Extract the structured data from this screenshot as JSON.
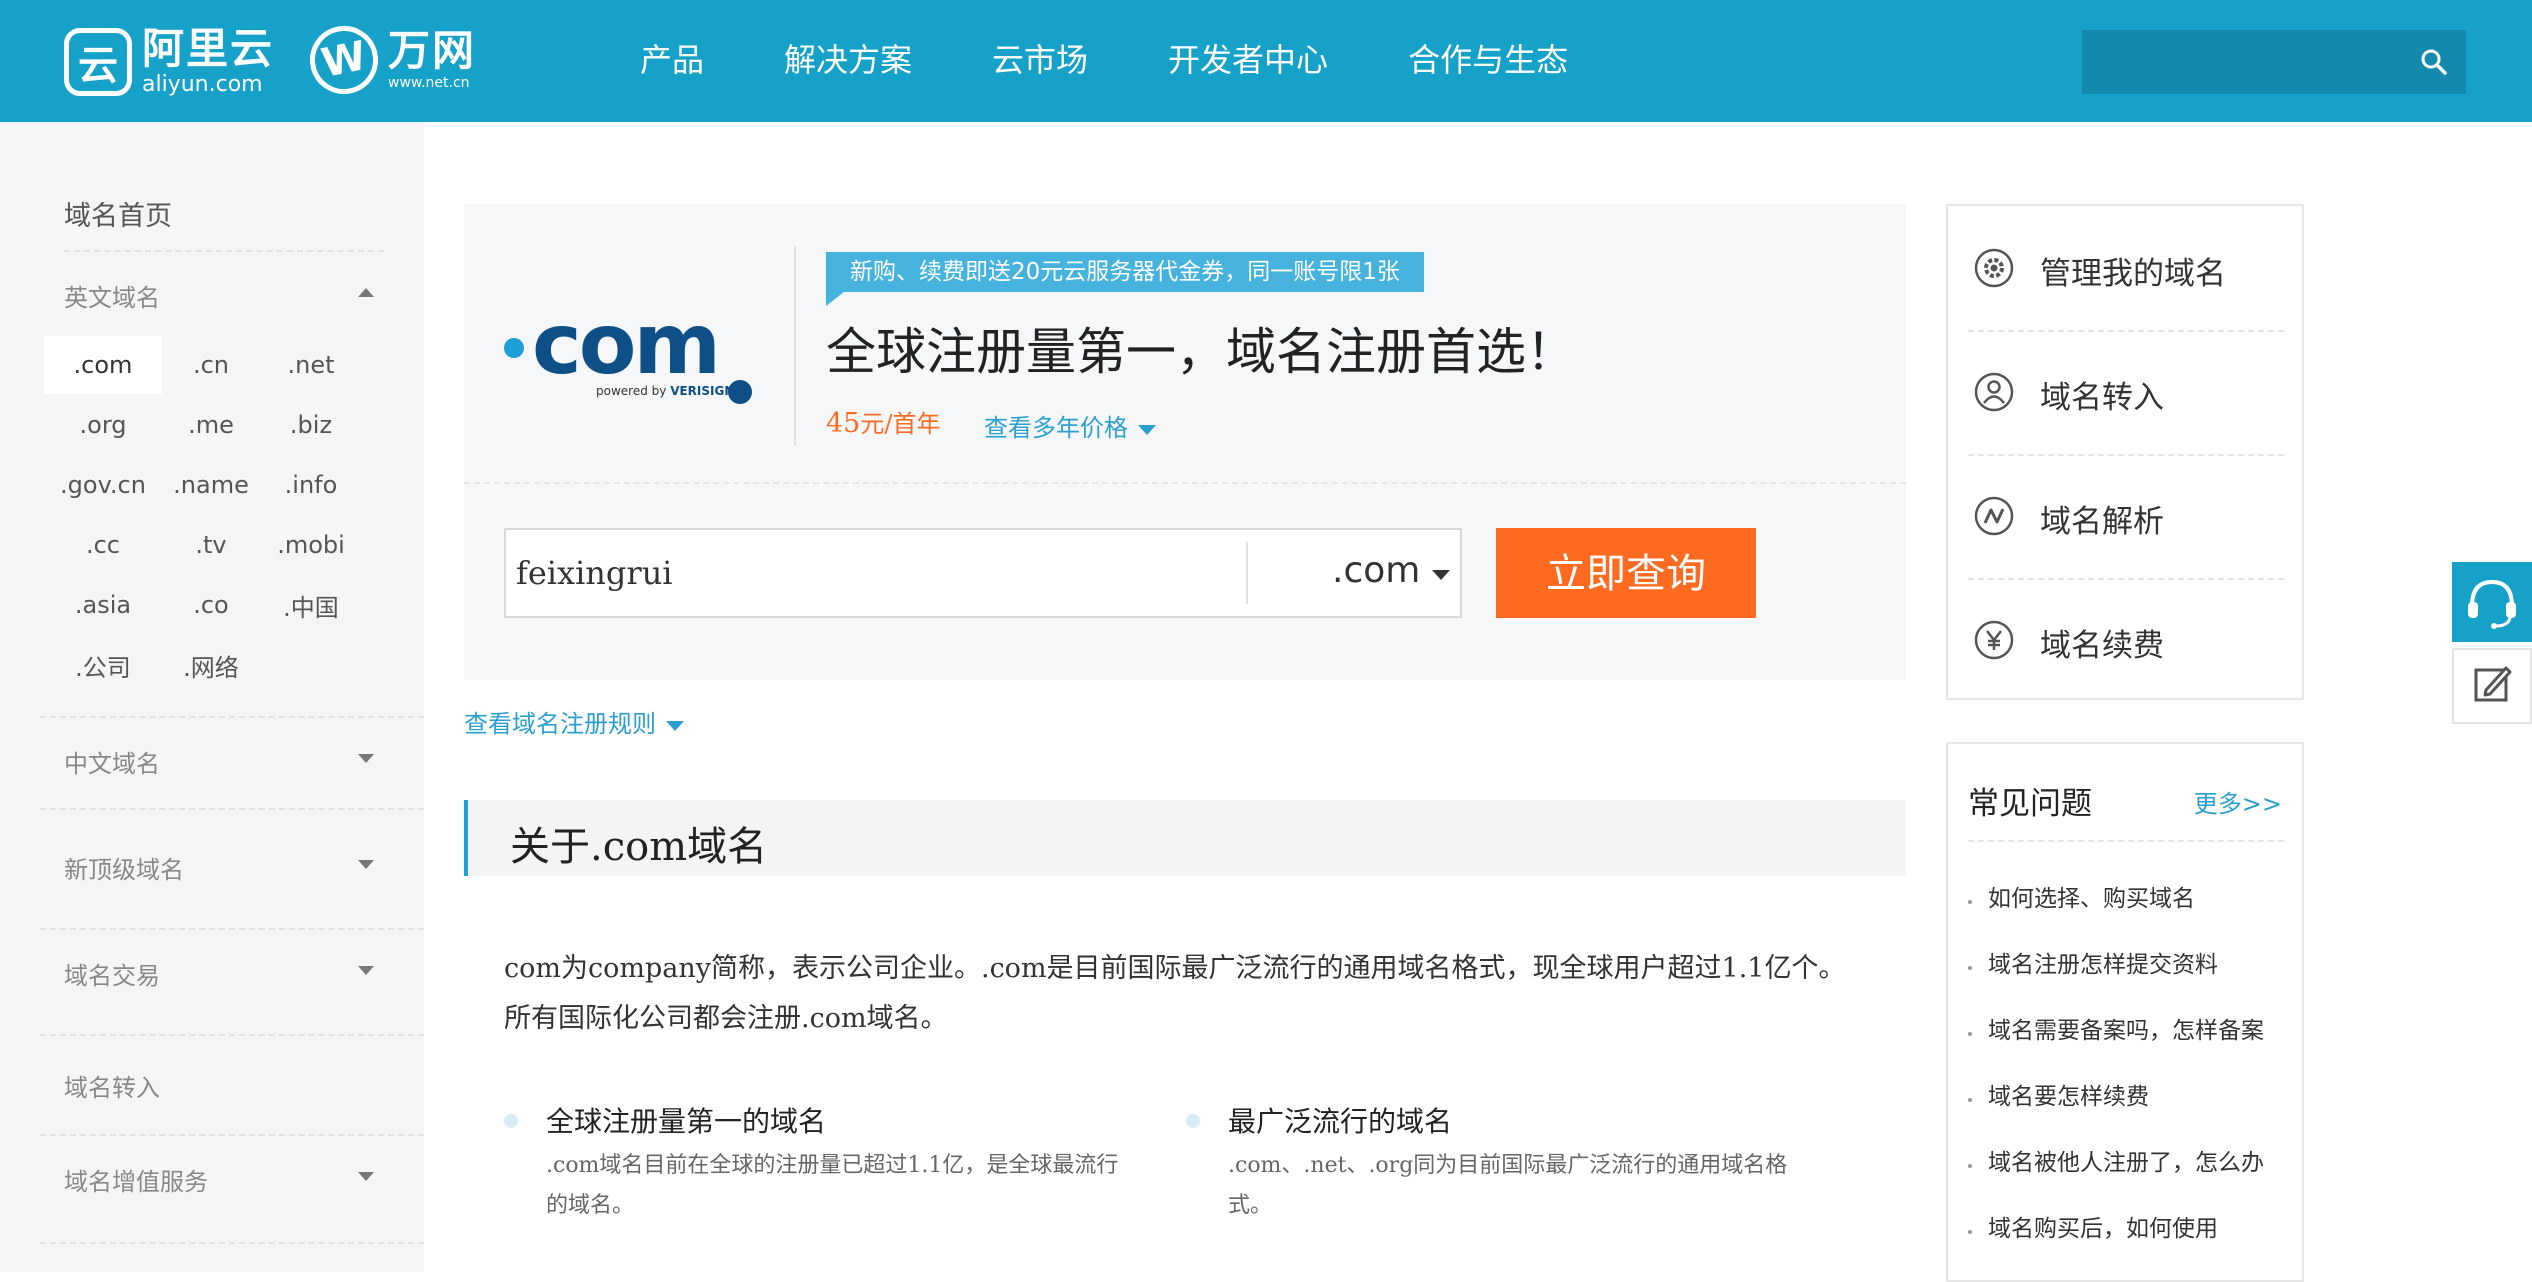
{
  "header": {
    "brand": {
      "name": "阿里云",
      "domain": "aliyun.com",
      "partner_name": "万网",
      "partner_domain": "www.net.cn"
    },
    "nav": [
      "产品",
      "解决方案",
      "云市场",
      "开发者中心",
      "合作与生态"
    ],
    "search_placeholder": ""
  },
  "sidebar": {
    "home": "域名首页",
    "english_domains": {
      "label": "英文域名",
      "tlds": [
        ".com",
        ".cn",
        ".net",
        ".org",
        ".me",
        ".biz",
        ".gov.cn",
        ".name",
        ".info",
        ".cc",
        ".tv",
        ".mobi",
        ".asia",
        ".co",
        ".中国",
        ".公司",
        ".网络"
      ],
      "selected": ".com"
    },
    "sections": [
      "中文域名",
      "新顶级域名",
      "域名交易",
      "域名转入",
      "域名增值服务"
    ]
  },
  "product": {
    "logo_text": "com",
    "logo_powered": "powered by",
    "logo_brand": "VERISIGN",
    "promo": "新购、续费即送20元云服务器代金券，同一账号限1张",
    "headline": "全球注册量第一，域名注册首选！",
    "price_value": "45",
    "price_unit": "元/首年",
    "multi_year_link": "查看多年价格"
  },
  "query": {
    "value": "feixingrui",
    "suffix": ".com",
    "button": "立即查询"
  },
  "rules_link": "查看域名注册规则",
  "about": {
    "title": "关于.com域名",
    "description_line1": "com为company简称，表示公司企业。.com是目前国际最广泛流行的通用域名格式，现全球用户超过1.1亿个。",
    "description_line2": "所有国际化公司都会注册.com域名。",
    "features": [
      {
        "title": "全球注册量第一的域名",
        "body": ".com域名目前在全球的注册量已超过1.1亿，是全球最流行的域名。"
      },
      {
        "title": "最广泛流行的域名",
        "body": ".com、.net、.org同为目前国际最广泛流行的通用域名格式。"
      }
    ]
  },
  "manage": [
    {
      "label": "管理我的域名",
      "icon": "gear-icon"
    },
    {
      "label": "域名转入",
      "icon": "user-icon"
    },
    {
      "label": "域名解析",
      "icon": "resolve-icon"
    },
    {
      "label": "域名续费",
      "icon": "yen-icon"
    }
  ],
  "faq": {
    "title": "常见问题",
    "more": "更多>>",
    "items": [
      "如何选择、购买域名",
      "域名注册怎样提交资料",
      "域名需要备案吗，怎样备案",
      "域名要怎样续费",
      "域名被他人注册了，怎么办",
      "域名购买后，如何使用"
    ]
  },
  "colors": {
    "header": "#16a1c9",
    "accent": "#ff6a21",
    "link": "#2a9fd0",
    "promo": "#46b3df"
  }
}
